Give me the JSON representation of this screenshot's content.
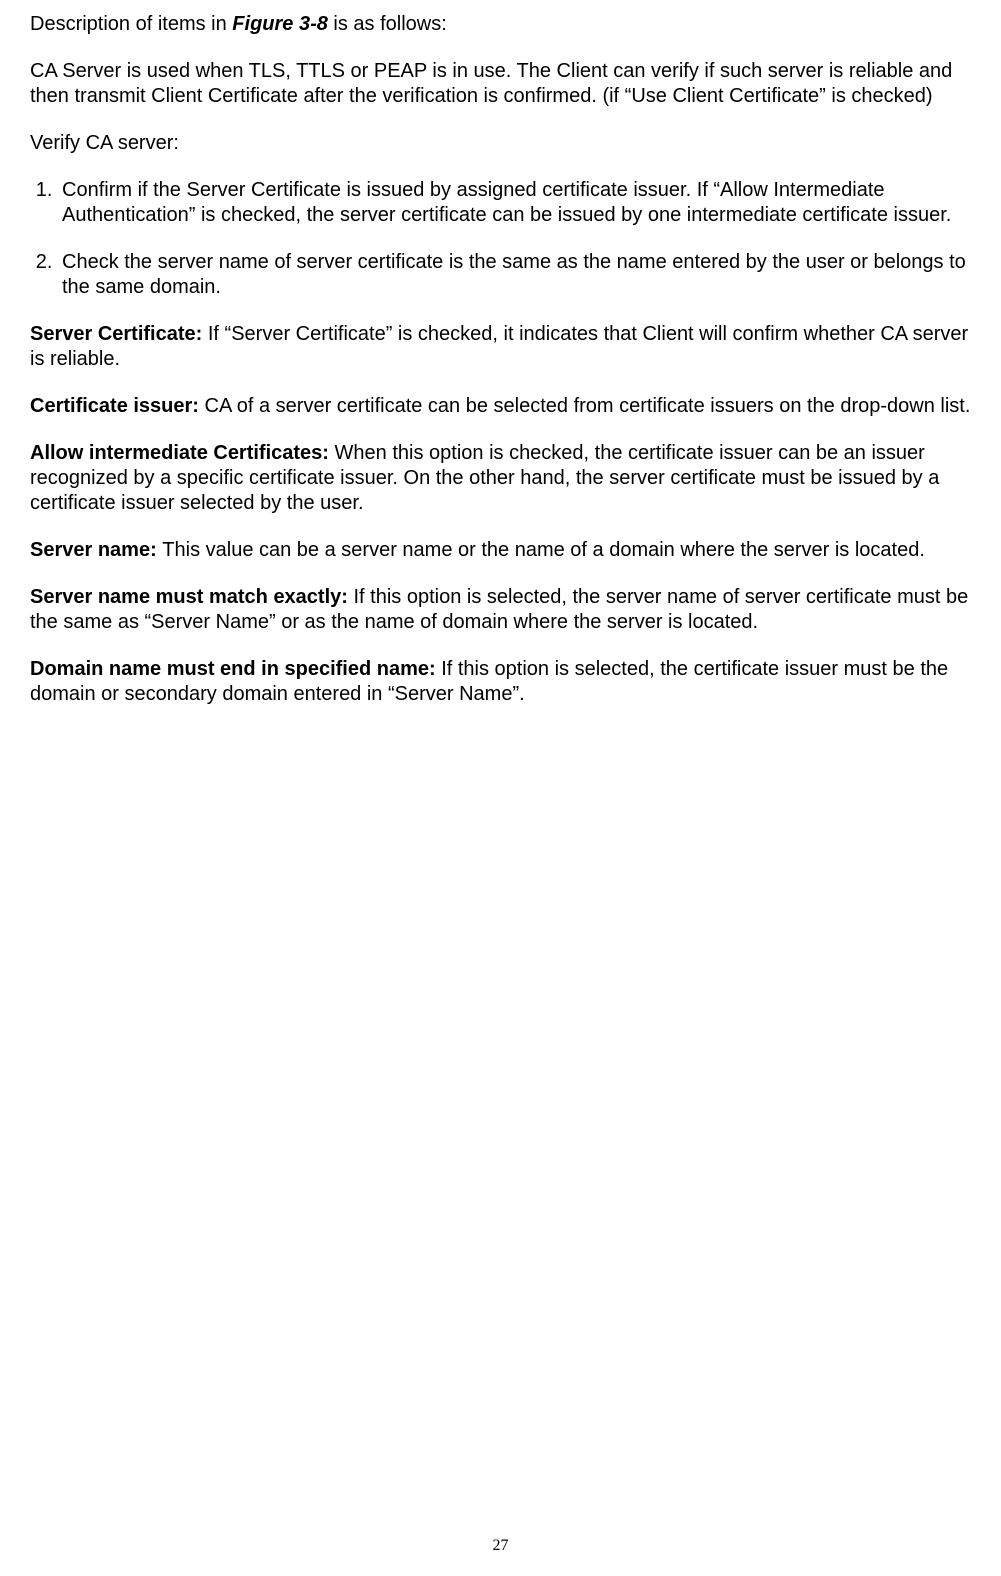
{
  "intro": {
    "prefix": "Description of items in ",
    "figure_ref": "Figure 3-8",
    "suffix": " is as follows:"
  },
  "ca_server_para": "CA Server is used when TLS, TTLS or PEAP is in use. The Client can verify if such server is reliable and then transmit Client Certificate after the verification is confirmed. (if “Use Client Certificate” is checked)",
  "verify_heading": "Verify CA server:",
  "list": {
    "item1": "Confirm if the Server Certificate is issued by assigned certificate issuer. If “Allow Intermediate Authentication” is checked, the server certificate can be issued by one intermediate certificate issuer.",
    "item2": "Check the server name of server certificate is the same as the name entered by the user or belongs to the same domain."
  },
  "defs": {
    "server_certificate": {
      "term": "Server Certificate: ",
      "body": "If “Server Certificate” is checked, it indicates that Client will confirm whether CA server is reliable."
    },
    "certificate_issuer": {
      "term": "Certificate issuer: ",
      "body": "CA of a server certificate can be selected from certificate issuers on the drop-down list."
    },
    "allow_intermediate": {
      "term": "Allow intermediate Certificates: ",
      "body": "When this option is checked, the certificate issuer can be an issuer recognized by a specific certificate issuer. On the other hand, the server certificate must be issued by a certificate issuer selected by the user."
    },
    "server_name": {
      "term": "Server name: ",
      "body": "This value can be a server name or the name of a domain where the server is located."
    },
    "match_exactly": {
      "term": "Server name must match exactly: ",
      "body": "If this option is selected, the server name of server certificate must be the same as “Server Name” or as the name of domain where the server is located."
    },
    "domain_end": {
      "term": "Domain name must end in specified name: ",
      "body": "If this option is selected, the certificate issuer must be the domain or secondary domain entered in “Server Name”."
    }
  },
  "page_number": "27"
}
